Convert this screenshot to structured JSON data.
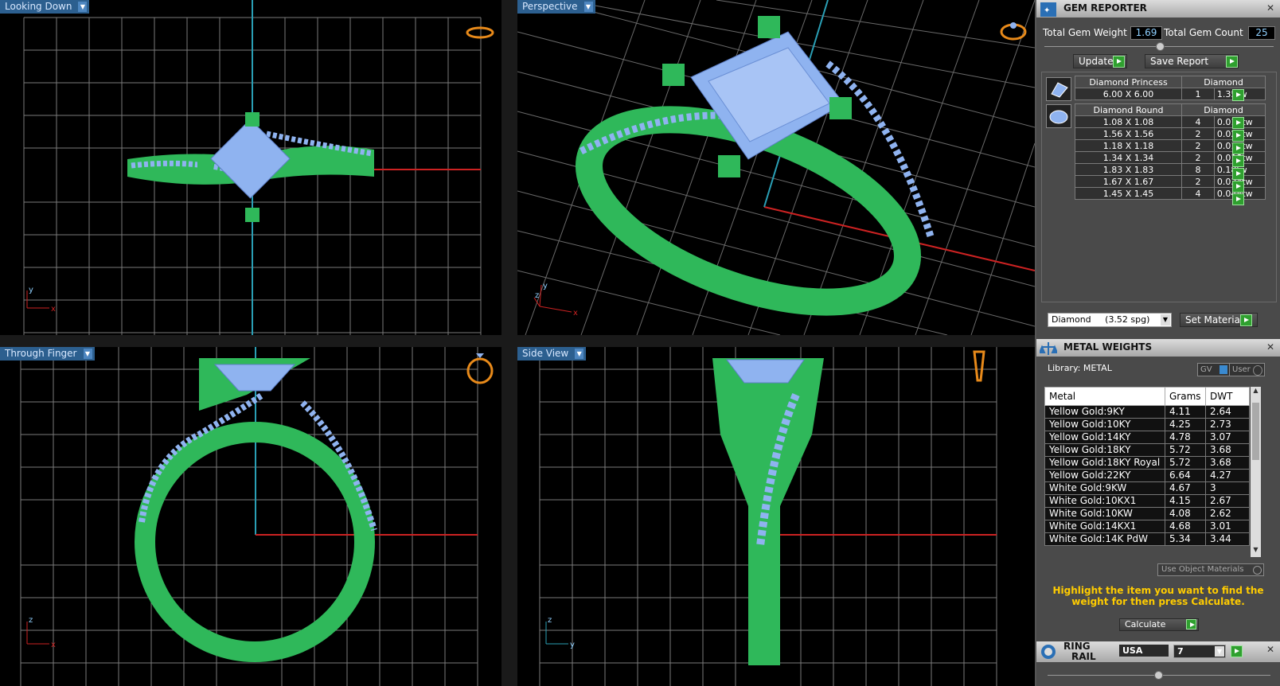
{
  "viewports": [
    {
      "label": "Looking Down",
      "axes": [
        "y",
        "x"
      ]
    },
    {
      "label": "Perspective",
      "axes": [
        "y",
        "z",
        "x"
      ]
    },
    {
      "label": "Through Finger",
      "axes": [
        "z",
        "x"
      ]
    },
    {
      "label": "Side View",
      "axes": [
        "z",
        "y"
      ]
    }
  ],
  "gem_reporter": {
    "title": "GEM REPORTER",
    "total_weight_label": "Total Gem Weight",
    "total_weight": "1.69",
    "total_count_label": "Total Gem Count",
    "total_count": "25",
    "update_label": "Update",
    "save_report_label": "Save Report",
    "princess": {
      "name": "Diamond Princess",
      "type": "Diamond",
      "rows": [
        {
          "size": "6.00 X 6.00",
          "count": "1",
          "weight": "1.35tw"
        }
      ]
    },
    "round": {
      "name": "Diamond Round",
      "type": "Diamond",
      "rows": [
        {
          "size": "1.08 X 1.08",
          "count": "4",
          "weight": "0.019tw"
        },
        {
          "size": "1.56 X 1.56",
          "count": "2",
          "weight": "0.028tw"
        },
        {
          "size": "1.18 X 1.18",
          "count": "2",
          "weight": "0.012tw"
        },
        {
          "size": "1.34 X 1.34",
          "count": "2",
          "weight": "0.018tw"
        },
        {
          "size": "1.83 X 1.83",
          "count": "8",
          "weight": "0.18tw"
        },
        {
          "size": "1.67 X 1.67",
          "count": "2",
          "weight": "0.034tw"
        },
        {
          "size": "1.45 X 1.45",
          "count": "4",
          "weight": "0.044tw"
        }
      ]
    },
    "material_select": "Diamond     (3.52 spg)",
    "set_material_label": "Set Material"
  },
  "metal_weights": {
    "title": "METAL WEIGHTS",
    "library_label": "Library:  METAL",
    "gv_label": "GV",
    "user_label": "User",
    "columns": [
      "Metal",
      "Grams",
      "DWT"
    ],
    "rows": [
      [
        "Yellow Gold:9KY",
        "4.11",
        "2.64"
      ],
      [
        "Yellow Gold:10KY",
        "4.25",
        "2.73"
      ],
      [
        "Yellow Gold:14KY",
        "4.78",
        "3.07"
      ],
      [
        "Yellow Gold:18KY",
        "5.72",
        "3.68"
      ],
      [
        "Yellow Gold:18KY Royal",
        "5.72",
        "3.68"
      ],
      [
        "Yellow Gold:22KY",
        "6.64",
        "4.27"
      ],
      [
        "White Gold:9KW",
        "4.67",
        "3"
      ],
      [
        "White Gold:10KX1",
        "4.15",
        "2.67"
      ],
      [
        "White Gold:10KW",
        "4.08",
        "2.62"
      ],
      [
        "White Gold:14KX1",
        "4.68",
        "3.01"
      ],
      [
        "White Gold:14K PdW",
        "5.34",
        "3.44"
      ]
    ],
    "use_object_materials_label": "Use Object Materials",
    "message": "Highlight the item you want to find the weight for then press Calculate.",
    "calculate_label": "Calculate"
  },
  "ring_rail": {
    "title_line1": "RING",
    "title_line2": "RAIL",
    "system": "USA",
    "size": "7"
  },
  "colors": {
    "ring_green": "#2fb85a",
    "gem_blue": "#8fb3f0",
    "grid": "#888888",
    "axis_red": "#cc2222",
    "axis_cyan": "#2a9fb5"
  }
}
